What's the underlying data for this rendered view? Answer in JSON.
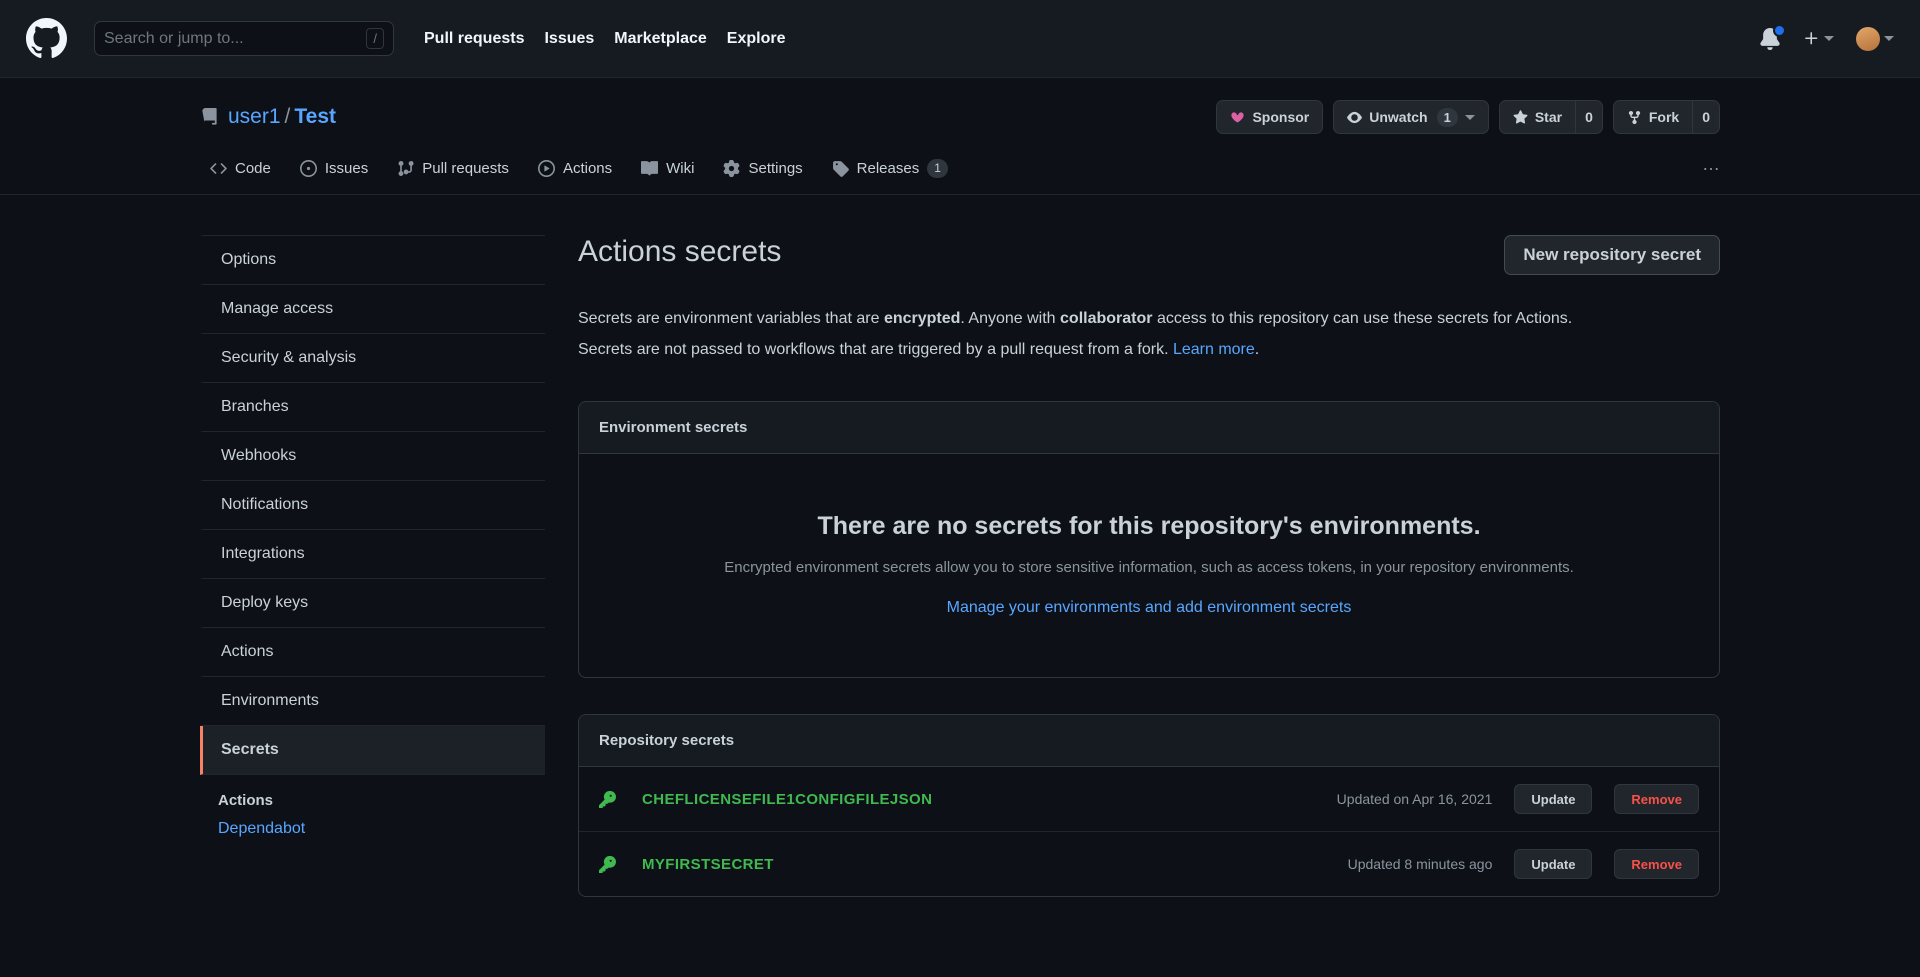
{
  "header": {
    "logo_icon": "github-mark-icon",
    "search": {
      "placeholder": "Search or jump to...",
      "shortcut": "/"
    },
    "nav": [
      "Pull requests",
      "Issues",
      "Marketplace",
      "Explore"
    ],
    "notifications_icon": "bell-icon",
    "create_new_icon": "plus-icon",
    "avatar_icon": "user-avatar"
  },
  "repo": {
    "icon": "repo-icon",
    "owner": "user1",
    "separator": "/",
    "name": "Test",
    "buttons": {
      "sponsor": "Sponsor",
      "unwatch": "Unwatch",
      "watch_count": "1",
      "star": "Star",
      "star_count": "0",
      "fork": "Fork",
      "fork_count": "0"
    },
    "tabs": [
      {
        "label": "Code",
        "icon": "code-icon",
        "badge": ""
      },
      {
        "label": "Issues",
        "icon": "issue-opened-icon",
        "badge": ""
      },
      {
        "label": "Pull requests",
        "icon": "git-pull-request-icon",
        "badge": ""
      },
      {
        "label": "Actions",
        "icon": "play-icon",
        "badge": ""
      },
      {
        "label": "Wiki",
        "icon": "book-icon",
        "badge": ""
      },
      {
        "label": "Settings",
        "icon": "gear-icon",
        "badge": ""
      },
      {
        "label": "Releases",
        "icon": "tag-icon",
        "badge": "1"
      }
    ],
    "overflow": "…"
  },
  "sidebar": {
    "items": [
      "Options",
      "Manage access",
      "Security & analysis",
      "Branches",
      "Webhooks",
      "Notifications",
      "Integrations",
      "Deploy keys",
      "Actions",
      "Environments",
      "Secrets"
    ],
    "selected": "Secrets",
    "sub_header": "Actions",
    "sub_items": [
      "Dependabot"
    ]
  },
  "main": {
    "title": "Actions secrets",
    "new_secret_button": "New repository secret",
    "description_line1_a": "Secrets are environment variables that are ",
    "description_line1_b": "encrypted",
    "description_line1_c": ". Anyone with ",
    "description_line1_d": "collaborator",
    "description_line1_e": " access to this repository can use these secrets for Actions.",
    "description_line2_a": "Secrets are not passed to workflows that are triggered by a pull request from a fork. ",
    "description_line2_link": "Learn more",
    "description_line2_b": ".",
    "environment_panel": {
      "header": "Environment secrets",
      "empty_title": "There are no secrets for this repository's environments.",
      "empty_subtitle": "Encrypted environment secrets allow you to store sensitive information, such as access tokens, in your repository environments.",
      "empty_link": "Manage your environments and add environment secrets"
    },
    "repository_panel": {
      "header": "Repository secrets",
      "rows": [
        {
          "icon": "key-icon",
          "name": "CHEFLICENSEFILE1CONFIGFILEJSON",
          "updated": "Updated on Apr 16, 2021",
          "update_button": "Update",
          "remove_button": "Remove"
        },
        {
          "icon": "key-icon",
          "name": "MYFIRSTSECRET",
          "updated": "Updated 8 minutes ago",
          "update_button": "Update",
          "remove_button": "Remove"
        }
      ]
    }
  },
  "colors": {
    "background": "#0d1117",
    "surface": "#161b22",
    "border": "#30363d",
    "link": "#58a6ff",
    "secret_green": "#3fb950",
    "danger_red": "#f85149",
    "selected_accent": "#f78166"
  }
}
